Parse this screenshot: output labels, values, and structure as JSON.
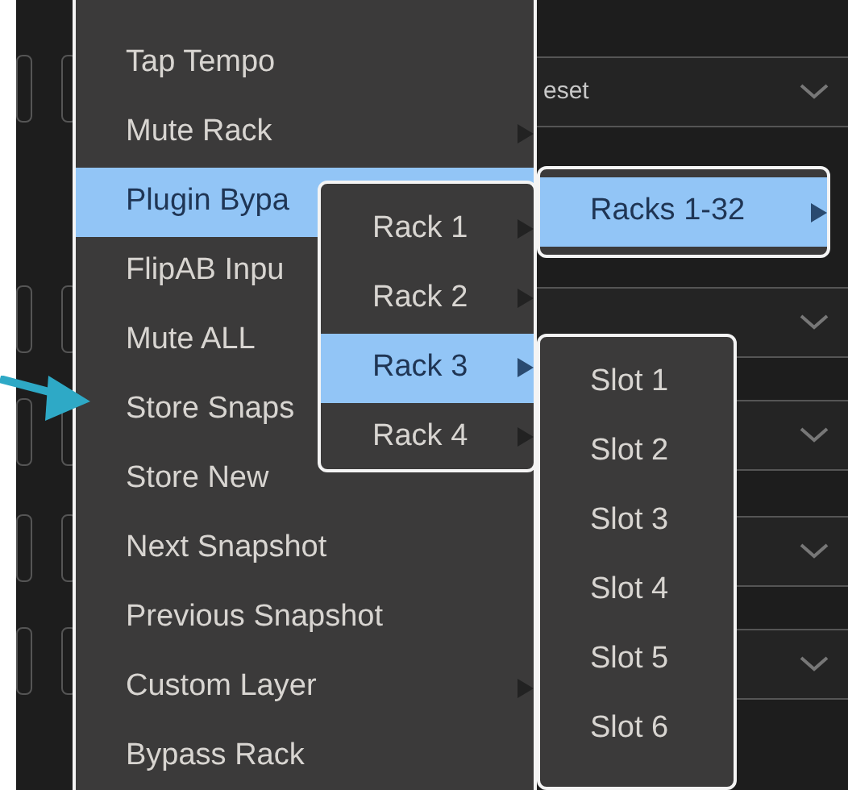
{
  "background": {
    "dropdown_fields": [
      {
        "value": "eset"
      }
    ]
  },
  "menus": [
    {
      "kind": "main",
      "items": [
        {
          "label": "Tap Tempo",
          "selected": false
        },
        {
          "label": "Mute Rack",
          "has_submenu": true,
          "selected": false
        },
        {
          "label": "Plugin Bypa",
          "selected": true
        },
        {
          "label": "FlipAB Inpu",
          "selected": false
        },
        {
          "label": "Mute ALL",
          "selected": false
        },
        {
          "label": "Store Snaps",
          "selected": false
        },
        {
          "label": "Store New",
          "selected": false
        },
        {
          "label": "Next Snapshot",
          "selected": false
        },
        {
          "label": "Previous Snapshot",
          "selected": false
        },
        {
          "label": "Custom Layer",
          "has_submenu": true,
          "selected": false
        },
        {
          "label": "Bypass Rack",
          "selected": false
        }
      ]
    },
    {
      "kind": "submenu",
      "items": [
        {
          "label": "Racks 1-32",
          "has_submenu": true,
          "selected": true
        }
      ]
    },
    {
      "kind": "submenu",
      "items": [
        {
          "label": "Rack 1",
          "has_submenu": true,
          "selected": false
        },
        {
          "label": "Rack 2",
          "has_submenu": true,
          "selected": false
        },
        {
          "label": "Rack 3",
          "has_submenu": true,
          "selected": true
        },
        {
          "label": "Rack 4",
          "has_submenu": true,
          "selected": false
        }
      ]
    },
    {
      "kind": "submenu",
      "items": [
        {
          "label": "Slot 1",
          "selected": false
        },
        {
          "label": "Slot 2",
          "selected": false
        },
        {
          "label": "Slot 3",
          "selected": false
        },
        {
          "label": "Slot 4",
          "selected": false
        },
        {
          "label": "Slot 5",
          "selected": false
        },
        {
          "label": "Slot 6",
          "selected": false
        }
      ]
    }
  ]
}
